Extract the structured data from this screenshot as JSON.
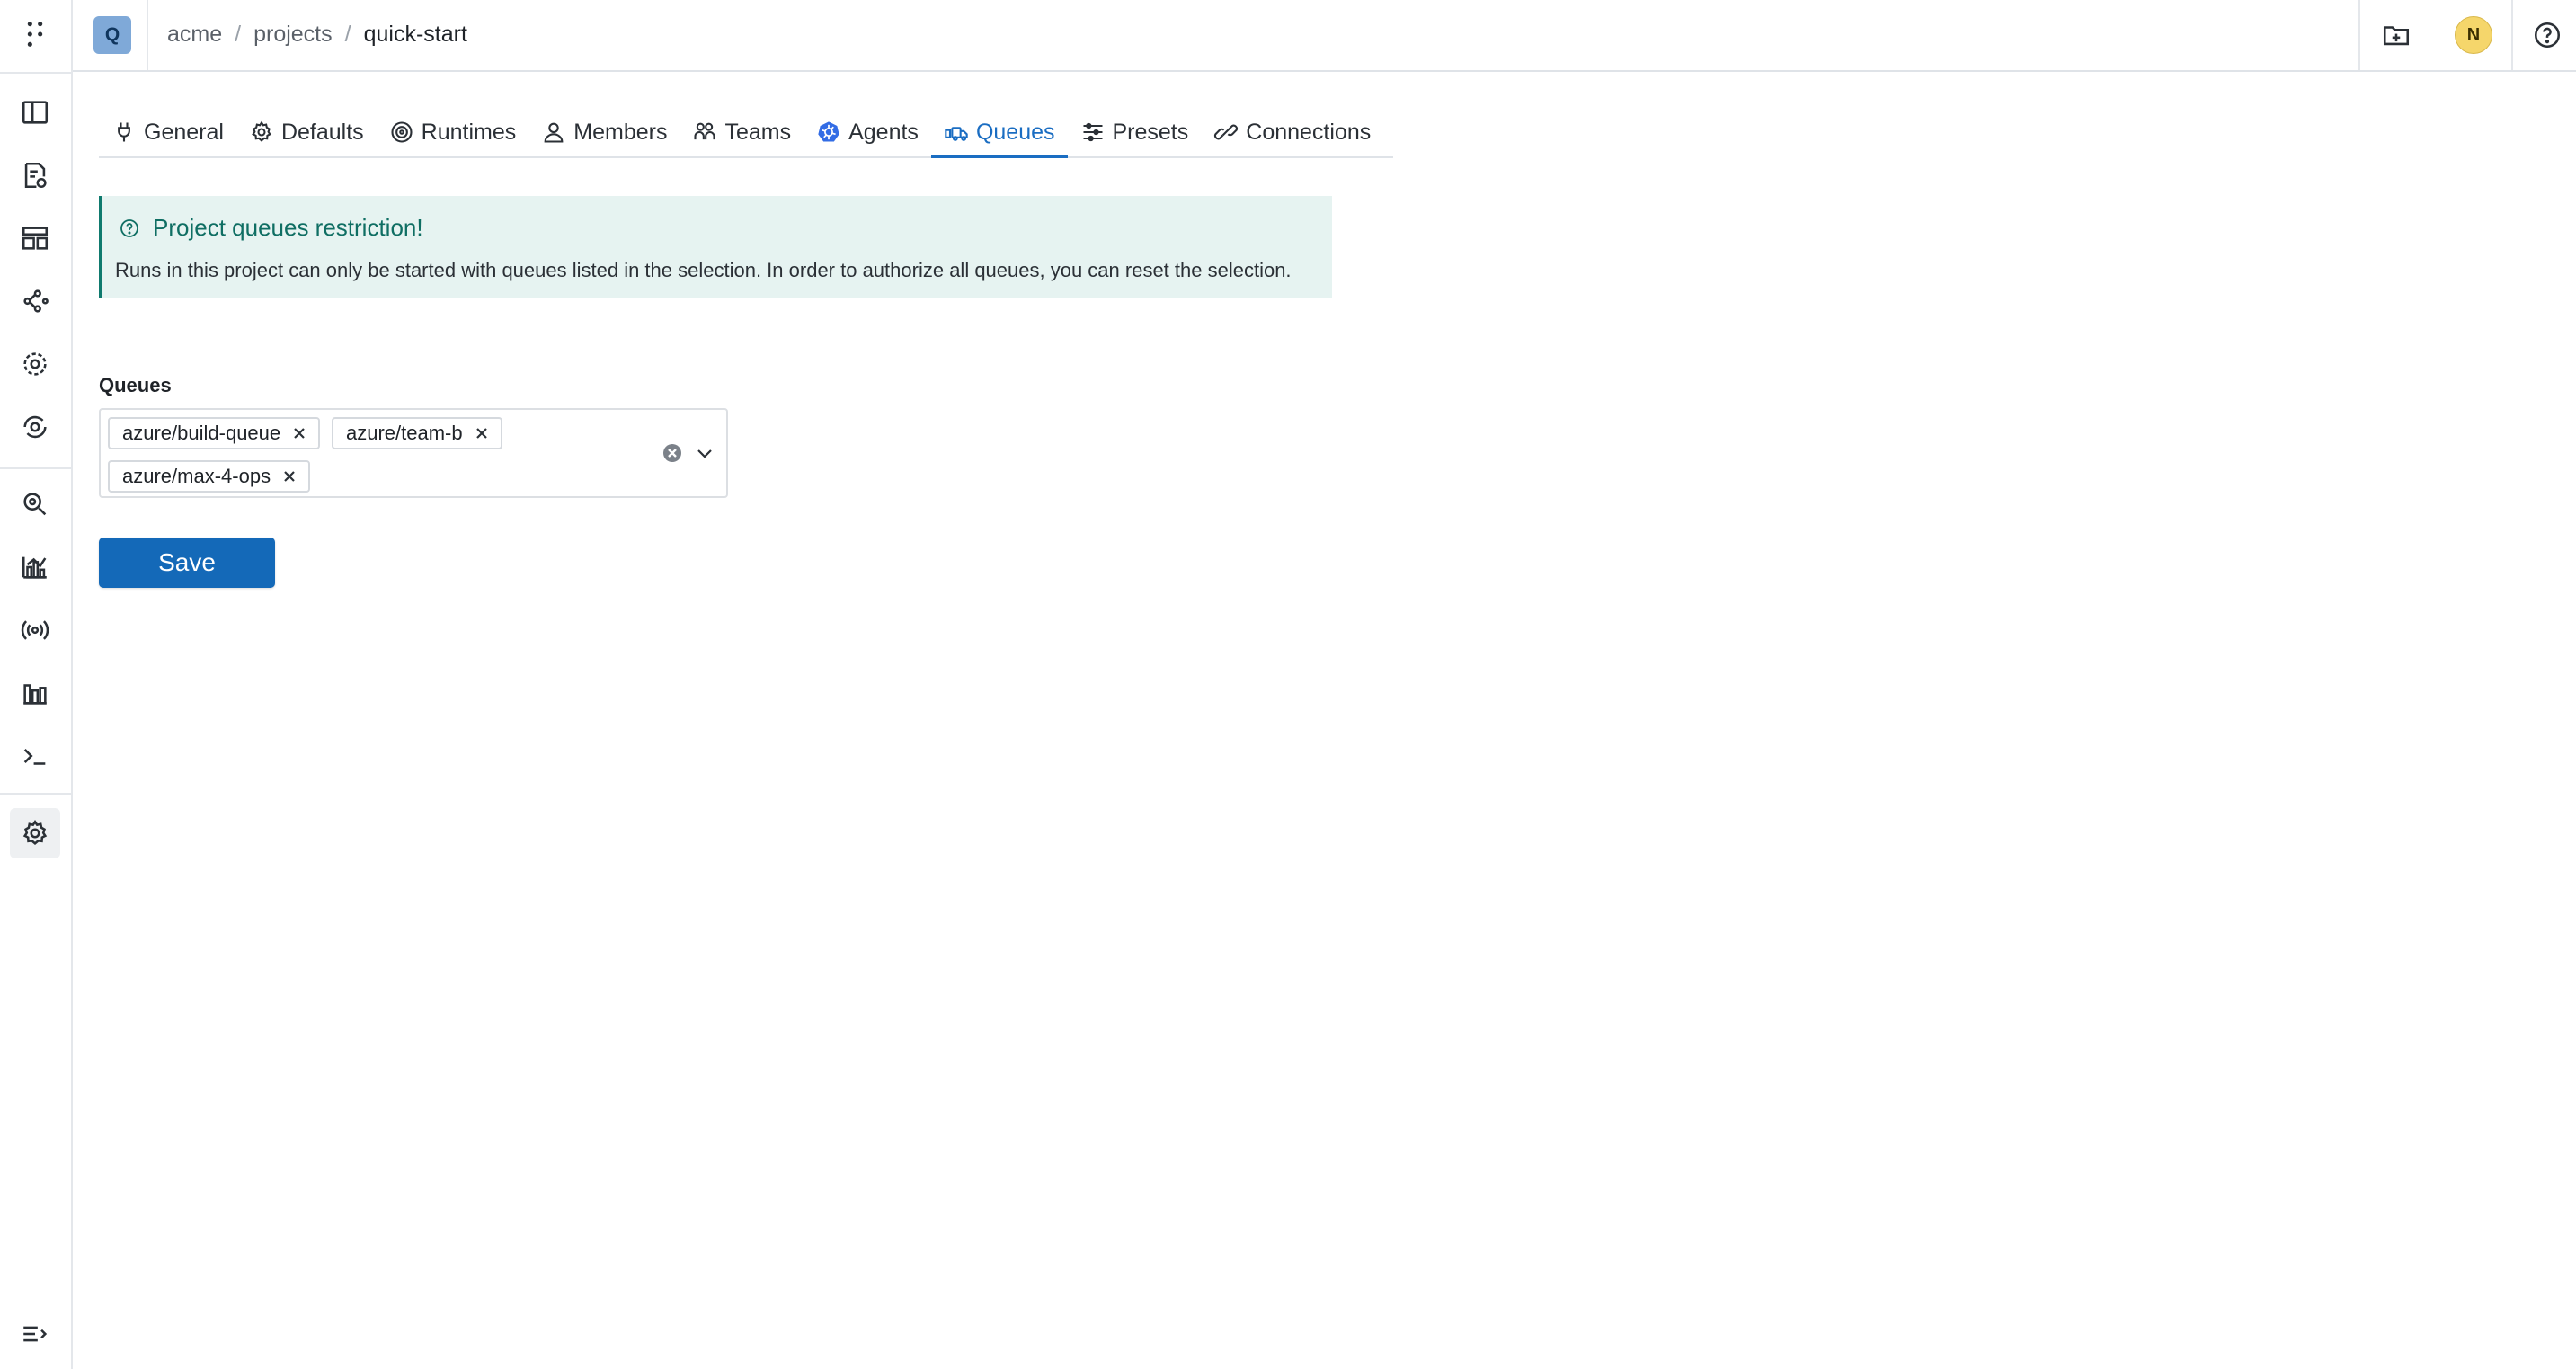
{
  "project": {
    "badge": "Q"
  },
  "breadcrumb": {
    "org": "acme",
    "section": "projects",
    "current": "quick-start",
    "separator": "/"
  },
  "user": {
    "avatar_initial": "N"
  },
  "rail": {
    "items": [
      "apps-grid-icon",
      "layout-panel-icon",
      "runs-icon",
      "dashboards-icon",
      "dag-icon",
      "components-icon",
      "models-icon",
      "search-icon",
      "analytics-icon",
      "broadcast-icon",
      "stats-icon",
      "terminal-icon",
      "settings-icon",
      "expand-menu-icon"
    ]
  },
  "tabs": [
    {
      "label": "General",
      "icon": "plug-icon"
    },
    {
      "label": "Defaults",
      "icon": "gear-icon"
    },
    {
      "label": "Runtimes",
      "icon": "target-icon"
    },
    {
      "label": "Members",
      "icon": "person-icon"
    },
    {
      "label": "Teams",
      "icon": "team-icon"
    },
    {
      "label": "Agents",
      "icon": "kubernetes-icon"
    },
    {
      "label": "Queues",
      "icon": "queue-icon",
      "active": true
    },
    {
      "label": "Presets",
      "icon": "presets-icon"
    },
    {
      "label": "Connections",
      "icon": "connection-icon"
    }
  ],
  "callout": {
    "title": "Project queues restriction!",
    "body": "Runs in this project can only be started with queues listed in the selection. In order to authorize all queues, you can reset the selection."
  },
  "queues": {
    "label": "Queues",
    "selected": [
      "azure/build-queue",
      "azure/team-b",
      "azure/max-4-ops"
    ]
  },
  "actions": {
    "save_label": "Save"
  },
  "colors": {
    "accent": "#1a6dc2",
    "save_button": "#1469b8",
    "callout_bg": "#e6f3f1",
    "callout_text": "#0f6e63",
    "avatar_bg": "#f5d66b",
    "badge_bg": "#7fa9d8"
  }
}
